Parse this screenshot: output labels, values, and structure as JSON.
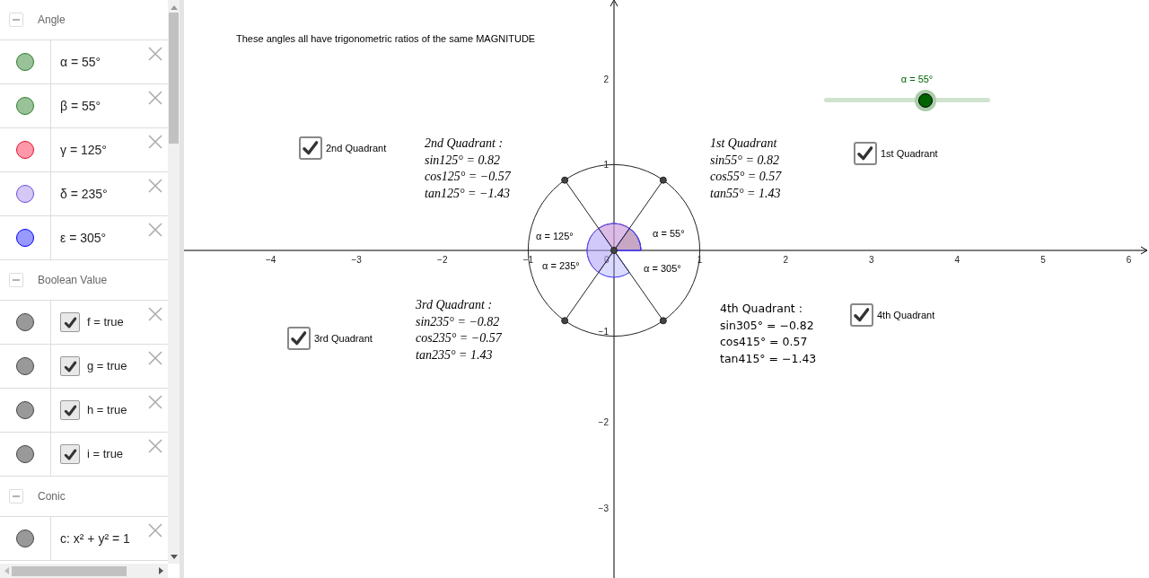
{
  "algebra": {
    "groups": [
      {
        "title": "Angle",
        "expanded": true,
        "items": [
          {
            "kind": "angle",
            "text": "α = 55°",
            "color": "#99c299"
          },
          {
            "kind": "angle",
            "text": "β = 55°",
            "color": "#99c299"
          },
          {
            "kind": "angle",
            "text": "γ = 125°",
            "color": "#ff99aa"
          },
          {
            "kind": "angle",
            "text": "δ = 235°",
            "color": "#d6c8f5"
          },
          {
            "kind": "angle",
            "text": "ε = 305°",
            "color": "#9999ff"
          }
        ]
      },
      {
        "title": "Boolean Value",
        "expanded": true,
        "items": [
          {
            "kind": "boolean",
            "text": "f = true",
            "color": "#999999",
            "checked": true
          },
          {
            "kind": "boolean",
            "text": "g = true",
            "color": "#999999",
            "checked": true
          },
          {
            "kind": "boolean",
            "text": "h = true",
            "color": "#999999",
            "checked": true
          },
          {
            "kind": "boolean",
            "text": "i = true",
            "color": "#999999",
            "checked": true
          }
        ]
      },
      {
        "title": "Conic",
        "expanded": true,
        "items": [
          {
            "kind": "conic",
            "text": "c: x² + y² = 1",
            "color": "#999999"
          }
        ]
      }
    ]
  },
  "graphics": {
    "heading": "These angles all have trigonometric ratios of the same MAGNITUDE",
    "x_tick_labels": [
      "−4",
      "−3",
      "−2",
      "−1",
      "1",
      "2",
      "3",
      "4",
      "5",
      "6"
    ],
    "origin_label": "0",
    "y_tick_labels": [
      "2",
      "1",
      "−1",
      "−2",
      "−3"
    ],
    "slider": {
      "label": "α = 55°",
      "level": 0.61
    },
    "checkboxes": [
      {
        "label": "2nd Quadrant",
        "checked": true
      },
      {
        "label": "1st Quadrant",
        "checked": true
      },
      {
        "label": "3rd Quadrant",
        "checked": true
      },
      {
        "label": "4th Quadrant",
        "checked": true
      }
    ],
    "quadrant_texts": [
      {
        "kind": "latex",
        "lines": [
          "2nd Quadrant :",
          "sin125° = 0.82",
          "cos125° = −0.57",
          "tan125° = −1.43"
        ]
      },
      {
        "kind": "latex",
        "lines": [
          "1st Quadrant",
          "sin55° = 0.82",
          "cos55° = 0.57",
          "tan55° = 1.43"
        ]
      },
      {
        "kind": "latex",
        "lines": [
          "3rd Quadrant :",
          "sin235° = −0.82",
          "cos235° = −0.57",
          "tan235° = 1.43"
        ]
      },
      {
        "kind": "plain",
        "lines": [
          "4th Quadrant :",
          "sin305° = −0.82",
          "cos415° = 0.57",
          "tan415° = −1.43"
        ]
      }
    ],
    "angle_labels": [
      "α = 125°",
      "α = 55°",
      "α = 235°",
      "α = 305°"
    ]
  }
}
